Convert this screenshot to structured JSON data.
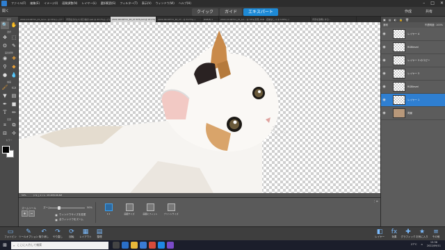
{
  "menu": {
    "items": [
      "ファイル(F)",
      "編集(E)",
      "イメージ(I)",
      "画質調整(N)",
      "レイヤー(L)",
      "選択範囲(S)",
      "フィルター(T)",
      "表示(V)",
      "ウィンドウ(W)",
      "ヘルプ(H)"
    ]
  },
  "modebar": {
    "open_label": "開く",
    "modes": [
      "クイック",
      "ガイド",
      "エキスパート"
    ],
    "active_mode": "エキスパート",
    "create_label": "作成",
    "share_label": "共有"
  },
  "tools": {
    "sections": [
      "表示",
      "選択",
      "画質調整",
      "描画",
      "変更",
      "カラー"
    ]
  },
  "doc_tabs": [
    "2022-10-04T11_21_12-A.. @ 33%(レイヤー 1, RGB/8)",
    "背景をきれいに切り抜き.psd @ 43.7%(レイヤー 1)",
    "2022-09-04T11_40_27-675.psd @ 22.1%(レイヤー 1)",
    "2022-09-04T11_40_27.. @ 31.5%(..)",
    "RGB/8) x",
    "2022-10-04T11_21_12-.. @ 33%(背景, RGB/8)",
    "名前なし-1 @ 100%(..)",
    "背景を透明にする.."
  ],
  "status": {
    "zoom": "50%",
    "doc_info": "ドキュメント: 93.4M/166.6M"
  },
  "options": {
    "title": "ズームツール",
    "zoom_label": "ズーム:",
    "zoom_value": "50%",
    "zoom_fraction": 0.25,
    "radio1": "ウィンドウサイズを変更",
    "radio2": "全ウィンドウをズーム",
    "buttons": [
      "1:1",
      "画面サイズ",
      "画面にフィット",
      "プリントサイズ"
    ]
  },
  "layers_panel": {
    "title": "レイヤー",
    "blend_mode": "通常",
    "opacity_label": "不透明度:",
    "opacity": "100%",
    "layers": [
      {
        "name": "レイヤー 4",
        "selected": false,
        "photo": false
      },
      {
        "name": "RGBlevel",
        "selected": false,
        "photo": false
      },
      {
        "name": "レイヤー 3 のコピー",
        "selected": false,
        "photo": false
      },
      {
        "name": "レイヤー 3",
        "selected": false,
        "photo": false
      },
      {
        "name": "RGBlevel",
        "selected": false,
        "photo": false
      },
      {
        "name": "レイヤー 1",
        "selected": true,
        "photo": false
      },
      {
        "name": "背景",
        "selected": false,
        "photo": true
      }
    ]
  },
  "bottom_bar": {
    "left": [
      "フォトビン",
      "ツールオプション",
      "取り消し",
      "やり直し",
      "回転",
      "レイアウト",
      "整理"
    ],
    "right": [
      "レイヤー",
      "効果",
      "グラフィック",
      "お気に入り",
      "その他"
    ]
  },
  "taskbar": {
    "search_placeholder": "ここに入力して検索",
    "time": "15:36",
    "date": "2022/09/11",
    "weather": "27°C"
  },
  "colors": {
    "accent": "#2f7fd1",
    "panel": "#4a4a4a"
  }
}
